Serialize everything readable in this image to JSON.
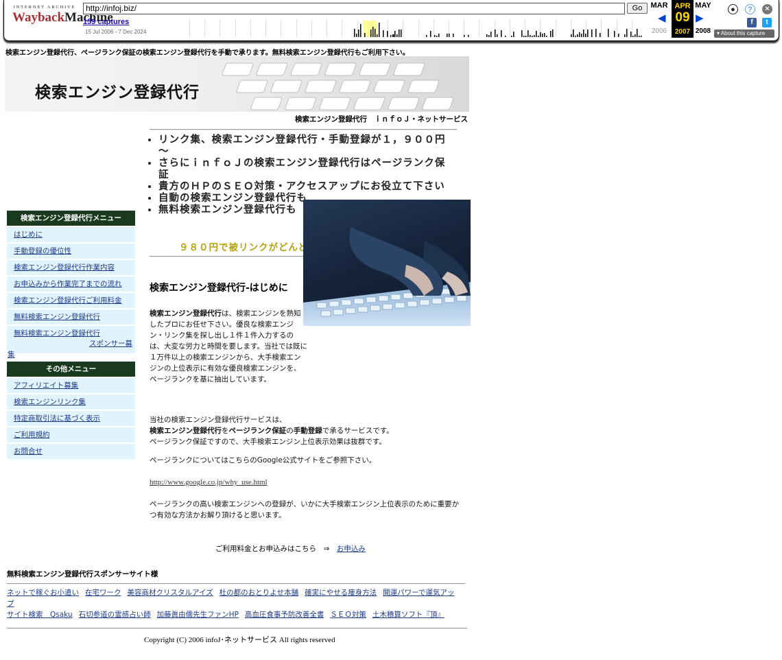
{
  "wayback": {
    "logo_top": "INTERNET ARCHIVE",
    "logo_word1": "Wayback",
    "logo_word2": "Machine",
    "url": "http://infoj.biz/",
    "go_label": "Go",
    "captures": "159 captures",
    "range": "15 Jul 2006 - 7 Dec 2024",
    "prev_month": "MAR",
    "cur_month": "APR",
    "next_month": "MAY",
    "cur_day": "09",
    "prev_year": "2006",
    "cur_year": "2007",
    "next_year": "2008",
    "about": "About this capture",
    "capture_density": [
      0,
      0,
      0,
      0,
      0,
      0,
      0,
      0,
      0,
      0,
      0,
      1,
      0,
      0,
      0,
      0,
      0,
      0,
      0,
      0,
      0,
      0,
      0,
      0,
      0,
      0,
      0,
      0,
      0,
      0,
      0,
      0,
      1,
      0,
      0,
      0,
      0,
      0,
      0,
      0,
      0,
      0,
      0,
      0,
      0,
      0,
      0,
      0,
      0,
      0,
      0,
      0,
      0,
      0,
      0,
      0,
      0,
      0,
      0,
      0,
      0,
      0,
      0,
      0,
      0,
      0,
      0,
      0,
      0,
      0,
      0,
      0,
      0,
      0,
      0,
      0,
      0,
      0,
      0,
      0,
      0,
      0,
      0,
      0,
      0,
      0,
      0,
      0,
      0,
      0,
      0,
      0,
      0,
      0,
      0,
      0,
      0,
      0,
      0,
      0,
      0,
      0,
      0,
      0,
      0,
      0,
      0,
      0,
      0,
      0,
      0,
      0,
      0,
      0,
      0,
      0,
      0,
      0,
      0,
      0,
      0,
      0,
      0,
      0,
      0,
      0,
      0,
      0,
      0,
      0,
      0,
      0,
      0,
      0,
      0,
      0,
      0,
      0,
      0,
      0,
      0,
      0,
      0,
      0,
      0,
      0,
      0,
      0,
      0,
      0,
      0,
      0,
      0,
      0,
      0,
      0,
      0,
      0,
      0,
      0,
      0,
      0,
      0,
      0,
      0,
      0,
      0,
      0,
      0,
      0,
      0,
      0,
      0,
      0,
      0,
      0,
      0,
      0,
      0,
      0,
      0,
      0,
      0,
      0,
      0,
      0,
      0,
      0,
      0,
      0,
      0,
      0,
      0,
      0,
      0,
      0,
      0,
      0,
      0,
      0,
      0,
      0,
      0,
      0,
      0,
      0,
      0,
      0,
      0,
      0,
      0,
      0,
      0,
      0,
      0,
      0,
      0,
      0,
      0,
      0,
      0,
      0,
      0,
      0,
      0,
      0,
      0,
      0,
      0,
      0,
      0,
      0,
      0,
      0,
      0,
      0,
      0,
      0,
      0,
      0,
      0,
      0,
      0,
      0,
      0,
      0,
      0,
      0,
      0,
      0,
      0,
      0,
      0,
      0,
      0,
      0,
      0,
      0,
      0,
      0,
      0,
      0,
      0,
      0,
      0,
      0,
      0,
      0,
      0,
      0,
      0,
      0,
      0,
      0,
      0,
      0,
      0,
      0,
      0,
      0,
      0,
      0,
      0,
      0,
      0,
      0,
      0,
      0,
      0,
      0,
      0,
      0,
      0,
      0,
      0,
      0,
      0,
      0,
      0,
      0,
      0,
      0,
      0,
      0,
      0,
      0,
      0,
      0,
      0,
      0,
      0,
      0,
      0,
      0,
      0,
      0,
      0,
      0,
      0,
      0,
      0,
      0,
      0,
      0,
      0,
      0,
      0,
      0,
      0,
      0,
      0,
      0,
      0,
      0,
      0,
      0,
      0,
      0,
      0,
      0,
      0,
      0,
      0,
      0,
      0,
      0,
      0,
      0,
      0,
      0,
      0,
      0,
      0,
      0,
      0,
      0,
      0,
      0,
      0,
      0,
      0,
      0,
      0,
      0,
      0,
      0,
      0,
      0,
      0,
      0,
      0,
      0,
      0,
      0,
      0,
      0,
      0,
      0,
      0,
      0,
      0,
      0,
      0,
      0,
      0,
      0,
      0,
      0,
      0,
      0,
      0,
      0,
      0,
      0,
      0,
      0,
      0,
      0,
      0,
      0,
      0,
      0,
      0,
      0,
      0,
      0,
      0,
      0,
      0,
      0,
      0,
      0,
      0,
      0,
      0,
      0,
      0,
      0,
      0,
      0,
      0,
      0,
      0,
      0,
      0,
      0,
      0,
      0,
      0,
      0,
      0,
      0,
      0,
      0,
      0,
      0,
      0,
      0,
      0,
      0,
      0,
      0,
      0,
      0,
      0,
      0,
      0,
      0,
      0,
      0,
      0,
      0,
      0,
      0,
      0,
      0,
      0,
      0,
      0,
      0,
      0,
      0,
      0,
      0,
      0,
      0,
      0,
      0,
      0,
      0,
      0,
      0,
      0,
      0,
      0,
      0,
      0,
      0,
      0,
      0,
      0,
      0,
      0,
      0,
      0,
      0,
      0,
      0,
      0,
      0,
      0,
      0,
      0,
      0,
      0,
      0,
      0,
      0,
      0,
      0,
      0,
      0,
      0,
      0,
      0,
      0,
      0,
      0,
      0,
      0,
      0,
      0,
      0,
      0,
      0,
      0,
      0,
      0,
      0,
      0,
      0,
      0,
      0,
      0,
      0,
      0,
      0,
      0,
      0,
      0,
      0,
      0,
      0,
      0,
      0,
      0,
      0,
      0,
      0,
      0,
      0,
      0,
      0,
      0,
      0,
      0,
      0,
      0,
      0,
      0,
      0,
      0,
      0,
      0,
      0,
      0,
      0,
      0,
      0,
      0,
      0,
      0,
      0,
      0,
      0,
      0,
      0,
      0,
      0,
      0,
      0,
      0,
      0,
      0,
      0,
      0,
      0,
      0,
      0,
      0,
      0,
      0,
      0,
      0,
      0,
      0,
      0,
      0,
      0,
      0,
      0,
      0,
      0,
      0,
      0,
      0,
      0,
      0,
      0,
      0,
      0,
      0,
      0,
      0,
      0,
      0,
      0,
      0,
      0,
      0,
      0,
      0,
      0,
      0,
      0,
      0,
      0,
      0,
      0,
      0,
      0,
      0,
      0,
      0,
      0,
      0,
      0,
      0,
      0,
      0,
      0,
      0,
      0,
      0,
      0,
      0,
      0,
      0,
      0,
      0,
      0,
      0,
      0,
      0,
      0,
      0,
      0,
      0,
      0,
      0,
      0,
      0,
      0,
      0,
      0,
      0,
      0,
      0,
      0,
      0,
      0,
      0,
      0,
      0,
      0,
      0,
      0,
      0,
      0,
      0,
      0,
      0,
      0,
      0,
      0,
      0,
      0,
      0,
      0,
      0,
      0,
      0,
      0,
      0,
      0,
      0,
      0,
      0,
      0,
      0,
      0,
      0,
      0,
      0,
      0,
      0,
      0,
      0,
      0,
      0,
      0,
      0,
      0,
      0,
      0,
      0,
      0,
      0,
      0,
      0,
      0,
      0,
      0,
      0,
      0,
      0,
      0,
      0,
      0,
      0,
      0,
      0,
      0,
      0,
      0,
      0,
      0,
      0,
      0,
      0,
      0,
      0,
      0,
      0,
      0,
      0,
      0,
      0,
      0,
      0,
      0,
      0,
      0,
      0,
      0,
      0,
      0,
      0,
      0,
      0,
      0,
      0,
      0,
      0,
      0,
      0,
      0,
      0,
      0,
      0,
      0,
      0,
      0,
      0,
      0,
      0,
      0,
      0,
      0,
      0,
      0,
      0,
      0,
      0,
      0,
      0,
      0,
      0,
      0,
      0,
      0,
      0
    ]
  },
  "page": {
    "tagline": "検索エンジン登録代行、ページランク保証の検索エンジン登録代行を手動で承ります。無料検索エンジン登録代行もご利用下さい。",
    "banner_title": "検索エンジン登録代行",
    "site_name": "検索エンジン登録代行　ｉｎｆｏＪ・ネットサービス",
    "bullets": [
      "リンク集、検索エンジン登録代行・手動登録が１，９００円～",
      "さらにｉｎｆｏＪの検索エンジン登録代行はページランク保証",
      "貴方のＨＰのＳＥＯ対策・アクセスアップにお役立て下さい",
      "自動の検索エンジン登録代行も",
      "無料検索エンジン登録代行も"
    ],
    "promo": "９８０円で被リンクがどんど",
    "section_title": "検索エンジン登録代行-はじめに",
    "p1_bold": "検索エンジン登録代行",
    "p1_rest": "は、検索エンジンを熟知したプロにお任せ下さい。優良な検索エンジン・リンク集を探し出し１件１件入力するのは、大変な労力と時間を要します。当社では既に１万件以上の検索エンジンから、大手検索エンジンの上位表示に有効な優良検索エンジンを、ページランクを基に抽出しています。",
    "p2_a": "当社の検索エンジン登録代行サービスは、",
    "p2_b1": "検索エンジン登録代行",
    "p2_b2": "を",
    "p2_b3": "ページランク保証",
    "p2_b4": "の",
    "p2_b5": "手動登録",
    "p2_b6": "で承るサービスです。",
    "p2_c": "ページランク保証ですので、大手検索エンジン上位表示効果は抜群です。",
    "p3": "ページランクについてはこちらのGoogle公式サイトをご参照下さい。",
    "p4": "http://www.google.co.jp/why_use.html",
    "p5": "ページランクの高い検索エンジンへの登録が、いかに大手検索エンジン上位表示のために重要かつ有効な方法かお解り頂けると思います。",
    "apply_text": "ご利用料金とお申込みはこちら　⇒　",
    "apply_link": "お申込み"
  },
  "menu": {
    "title": "検索エンジン登録代行メニュー",
    "items": [
      "はじめに",
      "手動登録の優位性",
      "検索エンジン登録代行作業内容",
      "お申込みから作業完了までの流れ",
      "検索エンジン登録代行ご利用料金",
      "無料検索エンジン登録代行"
    ],
    "sponsor_item_a": "無料検索エンジン登録代行",
    "sponsor_item_b": "スポンサー募",
    "sponsor_item_c": "集",
    "other_title": "その他メニュー",
    "other_items": [
      "アフィリエイト募集",
      "検索エンジンリンク集",
      "特定商取引法に基づく表示",
      "ご利用規約",
      "お問合せ"
    ]
  },
  "footer": {
    "sponsor_title": "無料検索エンジン登録代行スポンサーサイト様",
    "sponsors": [
      "ネットで稼ぐお小遣い",
      "在宅ワーク",
      "美容商材クリスタルアイズ",
      "杜の都のおとりよせ本舗",
      "確実にやせる痩身方法",
      "開運パワーで運気アップ",
      "サイト検索　Qsaku",
      "石切参道の霊感占い師",
      "加藤眞由儒先生ファンHP",
      "高血圧食事予防改善全書",
      "ＳＥＯ対策",
      "土木積算ソフト『頂』"
    ],
    "copyright": "Copyright (C) 2006 infoJ･ネットサービス All rights reserved"
  }
}
